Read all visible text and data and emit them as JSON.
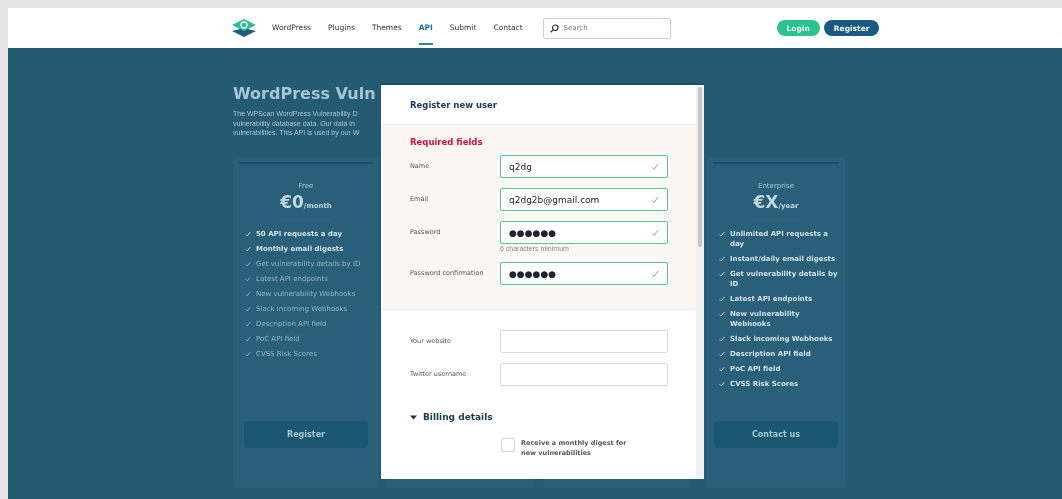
{
  "nav": {
    "items": [
      {
        "label": "WordPress",
        "selected": false
      },
      {
        "label": "Plugins",
        "selected": false
      },
      {
        "label": "Themes",
        "selected": false
      },
      {
        "label": "API",
        "selected": true
      },
      {
        "label": "Submit",
        "selected": false
      },
      {
        "label": "Contact",
        "selected": false
      }
    ],
    "search": {
      "placeholder": "Search"
    },
    "buttons": [
      {
        "label": "Login",
        "kind": "login"
      },
      {
        "label": "Register",
        "kind": "register"
      }
    ]
  },
  "page": {
    "heading": "WordPress Vuln",
    "description": [
      "The WPScan WordPress Vulnerability D",
      "vulnerability database data. Our data in",
      "vulnerabilities. This API is used by our W"
    ]
  },
  "plans": [
    {
      "name": "Free",
      "price": "€0",
      "period": "/month",
      "button": "Register",
      "features": [
        {
          "text": "50 API requests a day",
          "included": true
        },
        {
          "text": "Monthly email digests",
          "included": true
        },
        {
          "text": "Get vulnerability details by ID",
          "included": false
        },
        {
          "text": "Latest API endpoints",
          "included": false
        },
        {
          "text": "New vulnerability Webhooks",
          "included": false
        },
        {
          "text": "Slack incoming Webhooks",
          "included": false
        },
        {
          "text": "Description API field",
          "included": false
        },
        {
          "text": "PoC API field",
          "included": false
        },
        {
          "text": "CVSS Risk Scores",
          "included": false
        }
      ]
    },
    {
      "name": "Enterprise",
      "price": "€X",
      "period": "/year",
      "button": "Contact us",
      "features": [
        {
          "text": "Unlimited API requests a day",
          "included": true
        },
        {
          "text": "Instant/daily email digests",
          "included": true
        },
        {
          "text": "Get vulnerability details by ID",
          "included": true
        },
        {
          "text": "Latest API endpoints",
          "included": true
        },
        {
          "text": "New vulnerability Webhooks",
          "included": true
        },
        {
          "text": "Slack incoming Webhooks",
          "included": true
        },
        {
          "text": "Description API field",
          "included": true
        },
        {
          "text": "PoC API field",
          "included": true
        },
        {
          "text": "CVSS Risk Scores",
          "included": true
        }
      ]
    }
  ],
  "modal": {
    "title": "Register new user",
    "required_title": "Required fields",
    "required_fields": [
      {
        "label": "Name",
        "value": "q2dg",
        "valid": true
      },
      {
        "label": "Email",
        "value": "q2dg2b@gmail.com",
        "valid": true
      },
      {
        "label": "Password",
        "value": "●●●●●●",
        "valid": true,
        "hint": "6 characters minimum"
      },
      {
        "label": "Password confirmation",
        "value": "●●●●●●",
        "valid": true
      }
    ],
    "optional_fields": [
      {
        "label": "Your website"
      },
      {
        "label": "Twitter username"
      }
    ],
    "billing": {
      "label": "Billing details",
      "expanded": true
    },
    "digest": {
      "label": "Receive a monthly digest for new vulnerabilities",
      "checked": false
    }
  }
}
